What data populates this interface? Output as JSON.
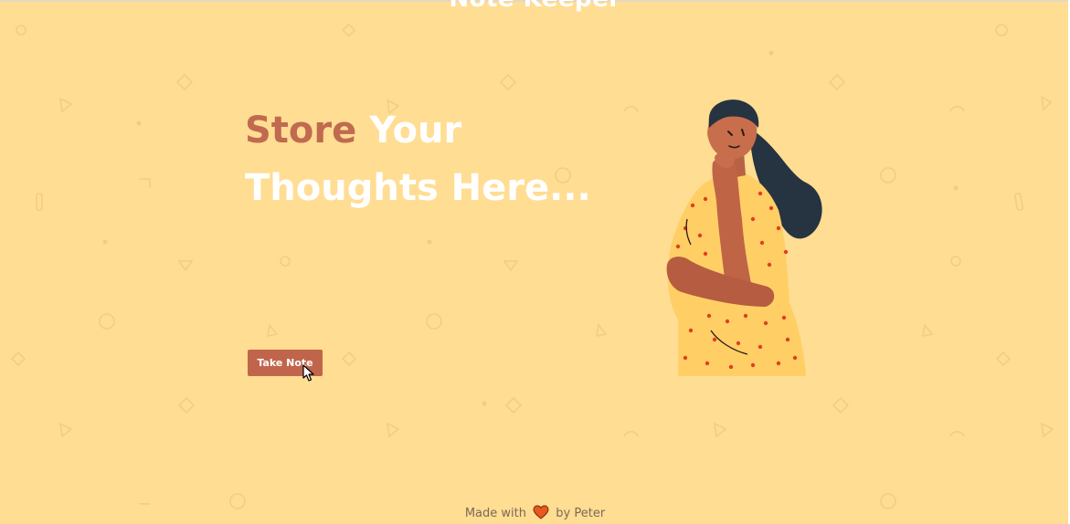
{
  "app": {
    "title": "Note Keeper"
  },
  "hero": {
    "headline_accent": "Store",
    "headline_rest_line1": " Your",
    "headline_line2": "Thoughts Here..."
  },
  "cta": {
    "label": "Take Note"
  },
  "footer": {
    "prefix": "Made with",
    "suffix": "by Peter",
    "icon": "heart-icon"
  },
  "colors": {
    "background": "#ffdd93",
    "accent": "#c0654c",
    "headline_text": "#ffffff",
    "heart": "#e8581c"
  },
  "illustration": {
    "subject": "thinking-woman-illustration"
  }
}
